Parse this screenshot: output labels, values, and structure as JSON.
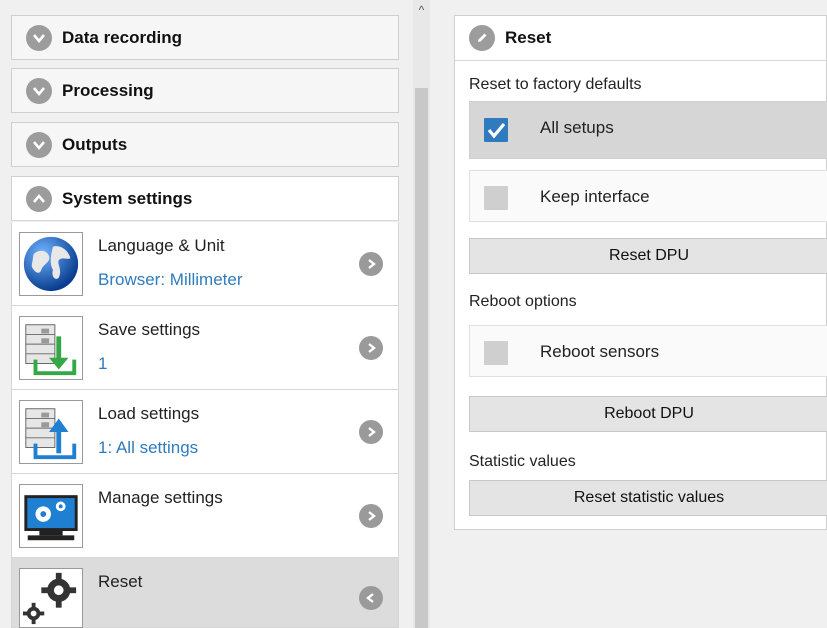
{
  "sidebar": {
    "sections": [
      {
        "label": "Data recording",
        "state": "collapsed"
      },
      {
        "label": "Processing",
        "state": "collapsed"
      },
      {
        "label": "Outputs",
        "state": "collapsed"
      },
      {
        "label": "System settings",
        "state": "expanded"
      }
    ],
    "items": [
      {
        "title": "Language & Unit",
        "subtitle": "Browser: Millimeter",
        "icon": "globe-icon"
      },
      {
        "title": "Save settings",
        "subtitle": "1",
        "icon": "save-settings-icon"
      },
      {
        "title": "Load settings",
        "subtitle": "1: All settings",
        "icon": "load-settings-icon"
      },
      {
        "title": "Manage settings",
        "subtitle": "",
        "icon": "manage-settings-icon"
      },
      {
        "title": "Reset",
        "subtitle": "",
        "icon": "gears-icon",
        "active": true
      }
    ]
  },
  "scrollbar": {
    "up_glyph": "^"
  },
  "panel": {
    "title": "Reset",
    "reset_label": "Reset to factory defaults",
    "all_setups": {
      "label": "All setups",
      "checked": true
    },
    "keep_interface": {
      "label": "Keep interface",
      "checked": false
    },
    "reset_dpu_button": "Reset DPU",
    "reboot_label": "Reboot options",
    "reboot_sensors": {
      "label": "Reboot sensors",
      "checked": false
    },
    "reboot_dpu_button": "Reboot DPU",
    "statistic_label": "Statistic values",
    "reset_statistic_button": "Reset statistic values"
  },
  "colors": {
    "accent": "#2f7bbd",
    "icon_grey": "#9c9c9c",
    "active_item": "#dcdcdc"
  }
}
